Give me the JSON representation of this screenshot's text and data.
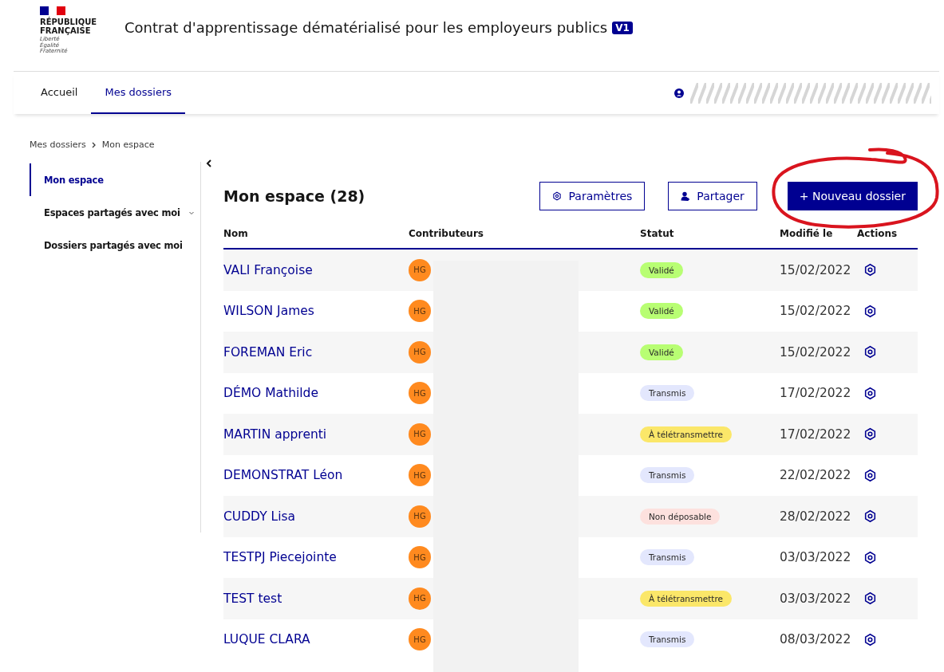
{
  "header": {
    "logo_lines": [
      "RÉPUBLIQUE",
      "FRANÇAISE"
    ],
    "motto": [
      "Liberté",
      "Égalité",
      "Fraternité"
    ],
    "title": "Contrat d'apprentissage dématérialisé pour les employeurs publics",
    "version_badge": "V1"
  },
  "nav": [
    {
      "label": "Accueil",
      "selected": false
    },
    {
      "label": "Mes dossiers",
      "selected": true
    }
  ],
  "breadcrumb": [
    "Mes dossiers",
    "Mon espace"
  ],
  "sidebar": {
    "items": [
      {
        "label": "Mon espace",
        "selected": true,
        "expandable": false
      },
      {
        "label": "Espaces partagés avec moi",
        "selected": false,
        "expandable": true
      },
      {
        "label": "Dossiers partagés avec moi",
        "selected": false,
        "expandable": false
      }
    ]
  },
  "main": {
    "title": "Mon espace (28)",
    "buttons": [
      {
        "label": "Paramètres",
        "kind": "settings"
      },
      {
        "label": "Partager",
        "kind": "share"
      },
      {
        "label": "+ Nouveau dossier",
        "kind": "primary"
      }
    ],
    "table": {
      "columns": [
        "Nom",
        "Contributeurs",
        "Statut",
        "Modifié le",
        "Actions"
      ],
      "rows": [
        {
          "name": "VALI Françoise",
          "contributor": "HG",
          "status": "Validé",
          "color": "#b8fe73",
          "modified": "15/02/2022"
        },
        {
          "name": "WILSON James",
          "contributor": "HG",
          "status": "Validé",
          "color": "#b8fe73",
          "modified": "15/02/2022"
        },
        {
          "name": "FOREMAN Eric",
          "contributor": "HG",
          "status": "Validé",
          "color": "#b8fe73",
          "modified": "15/02/2022"
        },
        {
          "name": "DÉMO Mathilde",
          "contributor": "HG",
          "status": "Transmis",
          "color": "#e3e7fd",
          "modified": "17/02/2022"
        },
        {
          "name": "MARTIN apprenti",
          "contributor": "HG",
          "status": "À télétransmettre",
          "color": "#fbe769",
          "modified": "17/02/2022"
        },
        {
          "name": "DEMONSTRAT Léon",
          "contributor": "HG",
          "status": "Transmis",
          "color": "#e3e7fd",
          "modified": "22/02/2022"
        },
        {
          "name": "CUDDY Lisa",
          "contributor": "HG",
          "status": "Non déposable",
          "color": "#fde1de",
          "modified": "28/02/2022"
        },
        {
          "name": "TESTPJ Piecejointe",
          "contributor": "HG",
          "status": "Transmis",
          "color": "#e3e7fd",
          "modified": "03/03/2022"
        },
        {
          "name": "TEST test",
          "contributor": "HG",
          "status": "À télétransmettre",
          "color": "#fbe769",
          "modified": "03/03/2022"
        },
        {
          "name": "LUQUE CLARA",
          "contributor": "HG",
          "status": "Transmis",
          "color": "#e3e7fd",
          "modified": "08/03/2022"
        }
      ]
    }
  }
}
